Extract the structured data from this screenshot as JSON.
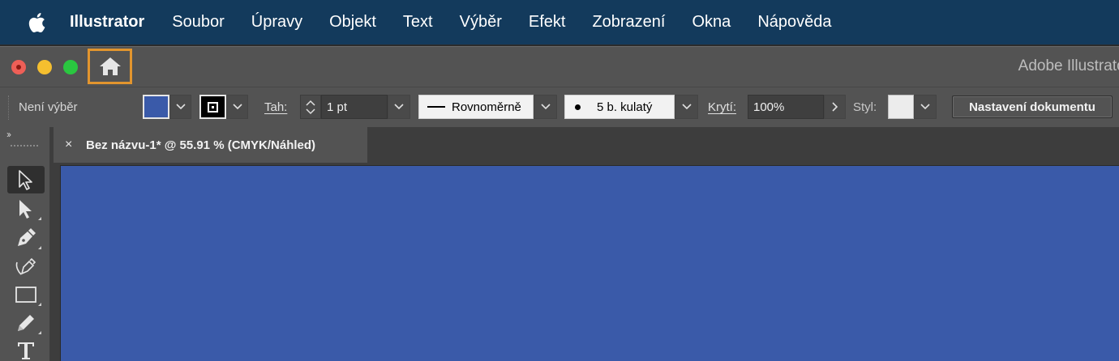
{
  "menubar": {
    "apple_icon": "apple-logo-icon",
    "app_name": "Illustrator",
    "items": [
      "Soubor",
      "Úpravy",
      "Objekt",
      "Text",
      "Výběr",
      "Efekt",
      "Zobrazení",
      "Okna",
      "Nápověda"
    ]
  },
  "window": {
    "title": "Adobe Illustrator",
    "home_icon": "home-icon",
    "home_highlight_color": "#e2952e"
  },
  "controlbar": {
    "selection_status": "Není výběr",
    "fill_color": "#3a5aa9",
    "stroke_color": "#000000",
    "stroke_label": "Tah:",
    "stroke_weight": "1 pt",
    "stroke_profile": "Rovnoměrně",
    "brush": "5 b. kulatý",
    "opacity_label": "Krytí:",
    "opacity": "100%",
    "style_label": "Styl:",
    "document_setup_button": "Nastavení dokumentu"
  },
  "tools": {
    "collapse": "››",
    "items": [
      "selection-tool",
      "direct-selection-tool",
      "pen-tool",
      "curvature-tool",
      "rectangle-tool",
      "pencil-tool",
      "type-tool"
    ]
  },
  "document": {
    "tab_close": "×",
    "tab_title": "Bez názvu-1* @ 55.91 % (CMYK/Náhled)",
    "artboard_color": "#3a5aa9"
  }
}
